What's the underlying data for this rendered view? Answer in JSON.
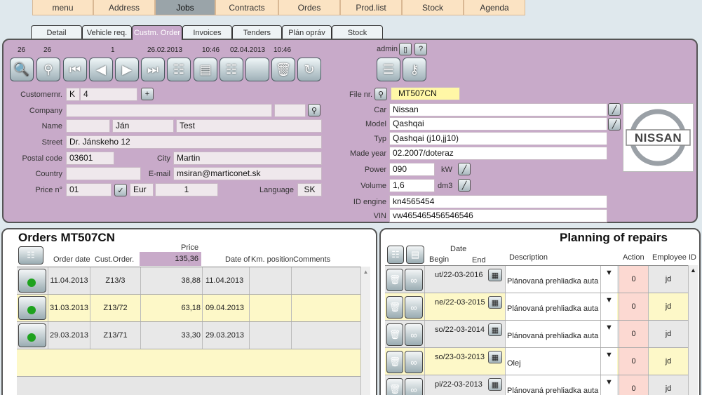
{
  "top_tabs": [
    {
      "label": "menu"
    },
    {
      "label": "Address"
    },
    {
      "label": "Jobs"
    },
    {
      "label": "Contracts"
    },
    {
      "label": "Ordes"
    },
    {
      "label": "Prod.list"
    },
    {
      "label": "Stock"
    },
    {
      "label": "Agenda"
    }
  ],
  "sub_tabs": [
    {
      "label": "Detail"
    },
    {
      "label": "Vehicle req."
    },
    {
      "label": "Custm. Order"
    },
    {
      "label": "Invoices"
    },
    {
      "label": "Tenders"
    },
    {
      "label": "Plán opráv"
    },
    {
      "label": "Stock"
    }
  ],
  "toolbar": {
    "counter_a": "26",
    "counter_b": "26",
    "counter_c": "1",
    "date1": "26.02.2013",
    "time1": "10:46",
    "date2": "02.04.2013",
    "time2": "10:46",
    "user": "admin"
  },
  "customer": {
    "customernr_label": "Customernr.",
    "customernr_prefix": "K",
    "customernr": "4",
    "company_label": "Company",
    "company": "",
    "company2": "",
    "name_label": "Name",
    "name_title": "",
    "first_name": "Ján",
    "last_name": "Test",
    "street_label": "Street",
    "street": "Dr. Jánskeho 12",
    "postal_label": "Postal code",
    "postal": "03601",
    "city_label": "City",
    "city": "Martin",
    "country_label": "Country",
    "country": "",
    "email_label": "E-mail",
    "email": "msiran@marticonet.sk",
    "price_label": "Price n°",
    "price_no": "01",
    "currency": "Eur",
    "price_extra": "1",
    "language_label": "Language",
    "language": "SK"
  },
  "vehicle": {
    "file_label": "File nr.",
    "file_nr": "MT507CN",
    "car_label": "Car",
    "car": "Nissan",
    "model_label": "Model",
    "model": "Qashqai",
    "typ_label": "Typ",
    "typ": "Qashqai (j10,jj10)",
    "year_label": "Made year",
    "year": "02.2007/doteraz",
    "power_label": "Power",
    "power": "090",
    "power_unit": "kW",
    "volume_label": "Volume",
    "volume": "1,6",
    "volume_unit": "dm3",
    "engine_label": "ID engine",
    "engine": "kn4565454",
    "vin_label": "VIN",
    "vin": "vw465465456546546",
    "logo_text": "NISSAN"
  },
  "orders": {
    "title": "Orders MT507CN",
    "headers": {
      "order_date": "Order date",
      "cust_order": "Cust.Order.",
      "price": "Price",
      "price_total": "135,36",
      "date_of": "Date of",
      "km": "Km. position",
      "comments": "Comments"
    },
    "rows": [
      {
        "order_date": "11.04.2013",
        "cust_order": "Z13/3",
        "price": "38,88",
        "date_of": "11.04.2013"
      },
      {
        "order_date": "31.03.2013",
        "cust_order": "Z13/72",
        "price": "63,18",
        "date_of": "09.04.2013"
      },
      {
        "order_date": "29.03.2013",
        "cust_order": "Z13/71",
        "price": "33,30",
        "date_of": "29.03.2013"
      }
    ]
  },
  "planning": {
    "title": "Planning of repairs",
    "headers": {
      "date": "Date",
      "begin": "Begin",
      "end": "End",
      "description": "Description",
      "action": "Action",
      "employee": "Employee ID"
    },
    "rows": [
      {
        "date": "ut/22-03-2016",
        "description": "Plánovaná prehliadka auta",
        "action": "0",
        "employee": "jd"
      },
      {
        "date": "ne/22-03-2015",
        "description": "Plánovaná prehliadka auta",
        "action": "0",
        "employee": "jd"
      },
      {
        "date": "so/22-03-2014",
        "description": "Plánovaná prehliadka auta",
        "action": "0",
        "employee": "jd"
      },
      {
        "date": "so/23-03-2013",
        "description": "Olej",
        "action": "0",
        "employee": "jd"
      },
      {
        "date": "pi/22-03-2013",
        "description": "Plánovaná prehliadka auta",
        "action": "0",
        "employee": "jd"
      }
    ]
  }
}
